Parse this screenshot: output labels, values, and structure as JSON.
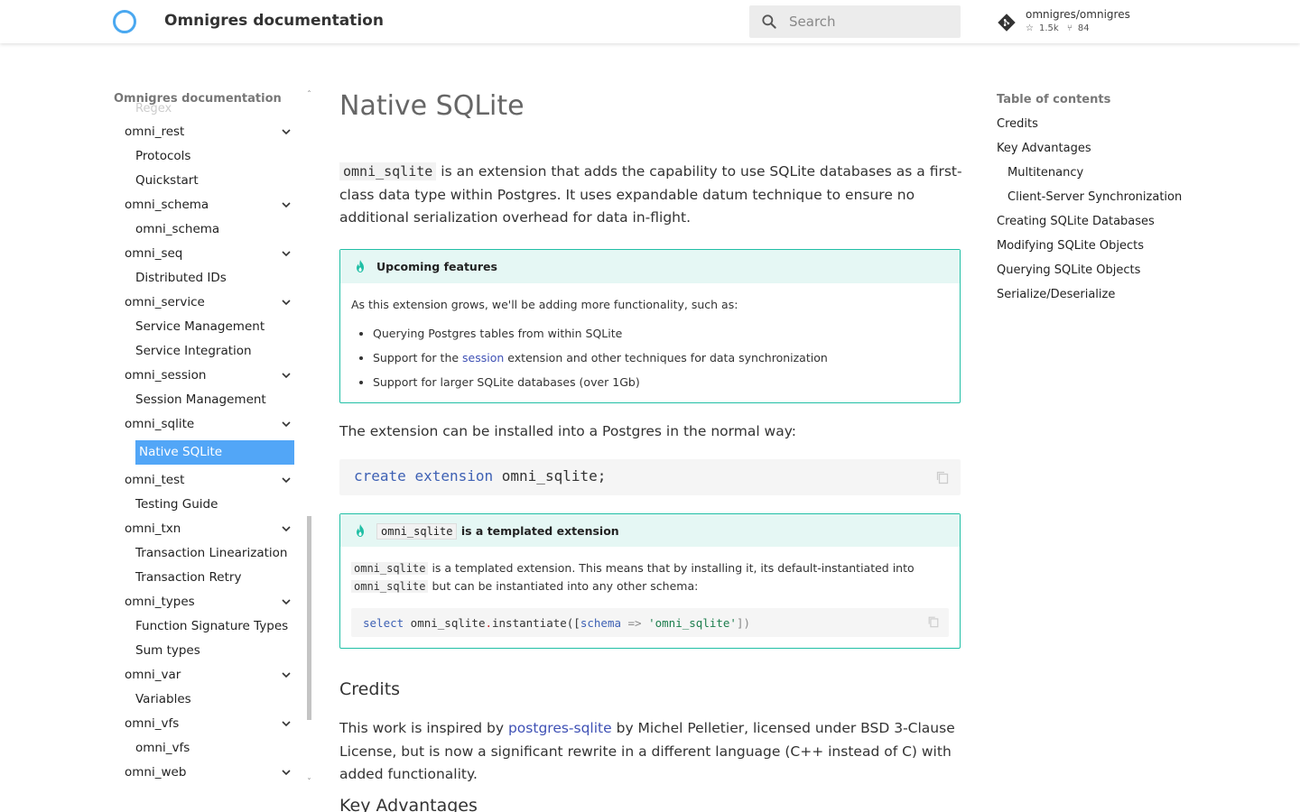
{
  "header": {
    "site_title": "Omnigres documentation",
    "search_placeholder": "Search",
    "repo_name": "omnigres/omnigres",
    "repo_stars": "1.5k",
    "repo_forks": "84"
  },
  "sidebar": {
    "title": "Omnigres documentation",
    "faded_item": "Regex",
    "items": [
      {
        "label": "omni_rest",
        "level": 1,
        "expandable": true
      },
      {
        "label": "Protocols",
        "level": 2
      },
      {
        "label": "Quickstart",
        "level": 2
      },
      {
        "label": "omni_schema",
        "level": 1,
        "expandable": true
      },
      {
        "label": "omni_schema",
        "level": 2
      },
      {
        "label": "omni_seq",
        "level": 1,
        "expandable": true
      },
      {
        "label": "Distributed IDs",
        "level": 2
      },
      {
        "label": "omni_service",
        "level": 1,
        "expandable": true
      },
      {
        "label": "Service Management",
        "level": 2
      },
      {
        "label": "Service Integration",
        "level": 2
      },
      {
        "label": "omni_session",
        "level": 1,
        "expandable": true
      },
      {
        "label": "Session Management",
        "level": 2
      },
      {
        "label": "omni_sqlite",
        "level": 1,
        "expandable": true
      },
      {
        "label": "Native SQLite",
        "level": 2,
        "active": true
      },
      {
        "label": "omni_test",
        "level": 1,
        "expandable": true
      },
      {
        "label": "Testing Guide",
        "level": 2
      },
      {
        "label": "omni_txn",
        "level": 1,
        "expandable": true
      },
      {
        "label": "Transaction Linearization",
        "level": 2
      },
      {
        "label": "Transaction Retry",
        "level": 2
      },
      {
        "label": "omni_types",
        "level": 1,
        "expandable": true
      },
      {
        "label": "Function Signature Types",
        "level": 2
      },
      {
        "label": "Sum types",
        "level": 2
      },
      {
        "label": "omni_var",
        "level": 1,
        "expandable": true
      },
      {
        "label": "Variables",
        "level": 2
      },
      {
        "label": "omni_vfs",
        "level": 1,
        "expandable": true
      },
      {
        "label": "omni_vfs",
        "level": 2
      },
      {
        "label": "omni_web",
        "level": 1,
        "expandable": true
      }
    ]
  },
  "main": {
    "title": "Native SQLite",
    "intro_code": "omni_sqlite",
    "intro_text": " is an extension that adds the capability to use SQLite databases as a first-class data type within Postgres. It uses expandable datum technique to ensure no additional serialization overhead for data in-flight.",
    "admonition1": {
      "title": "Upcoming features",
      "body": "As this extension grows, we'll be adding more functionality, such as:",
      "li1": "Querying Postgres tables from within SQLite",
      "li2_pre": "Support for the ",
      "li2_link": "session",
      "li2_post": " extension and other techniques for data synchronization",
      "li3": "Support for larger SQLite databases (over 1Gb)"
    },
    "install_text": "The extension can be installed into a Postgres in the normal way:",
    "code1": {
      "kw1": "create",
      "kw2": "extension",
      "rest": " omni_sqlite;"
    },
    "admonition2": {
      "title_code": "omni_sqlite",
      "title_text": " is a templated extension",
      "body_code1": "omni_sqlite",
      "body_text1": " is a templated extension. This means that by installing it, its default-instantiated into ",
      "body_code2": "omni_sqlite",
      "body_text2": " but can be instantiated into any other schema:",
      "code_kw": "select",
      "code_fn": " omni_sqlite",
      "code_dot": ".",
      "code_call": "instantiate([",
      "code_param": "schema",
      "code_arrow": " => ",
      "code_str": "'omni_sqlite'",
      "code_end": "])"
    },
    "credits_heading": "Credits",
    "credits_pre": "This work is inspired by ",
    "credits_link": "postgres-sqlite",
    "credits_post": " by Michel Pelletier, licensed under BSD 3-Clause License, but is now a significant rewrite in a different language (C++ instead of C) with added functionality.",
    "next_heading": "Key Advantages"
  },
  "toc": {
    "title": "Table of contents",
    "items": [
      {
        "label": "Credits",
        "sub": false
      },
      {
        "label": "Key Advantages",
        "sub": false
      },
      {
        "label": "Multitenancy",
        "sub": true
      },
      {
        "label": "Client-Server Synchronization",
        "sub": true
      },
      {
        "label": "Creating SQLite Databases",
        "sub": false
      },
      {
        "label": "Modifying SQLite Objects",
        "sub": false
      },
      {
        "label": "Querying SQLite Objects",
        "sub": false
      },
      {
        "label": "Serialize/Deserialize",
        "sub": false
      }
    ]
  },
  "colors": {
    "accent": "#52a6f7",
    "admonition_border": "#20bfa5",
    "admonition_bg": "#e5f7f4",
    "link": "#3f51b5"
  }
}
